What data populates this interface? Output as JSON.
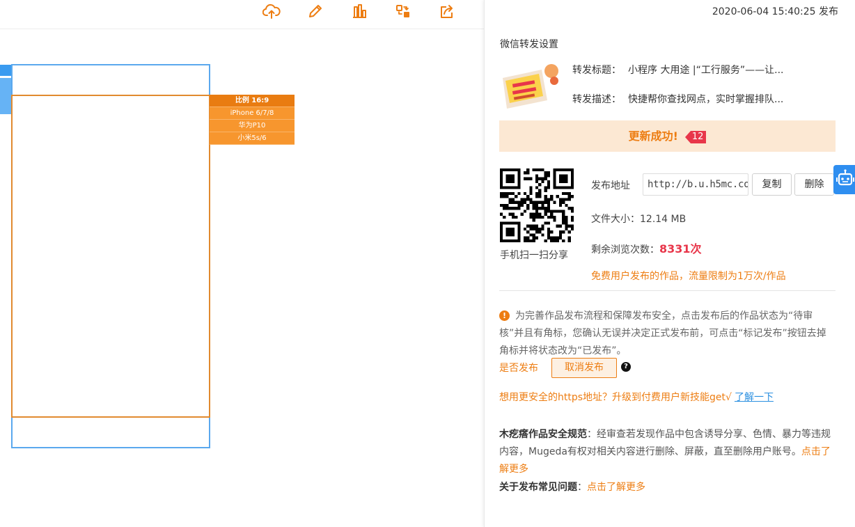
{
  "toolbar": {
    "icons": [
      "cloud-upload-icon",
      "pencil-icon",
      "bar-chart-icon",
      "share-transfer-icon",
      "export-icon"
    ]
  },
  "ratio_menu": {
    "items": [
      "比例 16:9",
      "iPhone 6/7/8",
      "华为P10",
      "小米5s/6"
    ],
    "active_index": 0
  },
  "panel": {
    "publish_time": "2020-06-04 15:40:25 发布",
    "wechat_title": "微信转发设置",
    "share_title_label": "转发标题：",
    "share_title_value": "小程序 大用途 |“工行服务”——让...",
    "share_desc_label": "转发描述：",
    "share_desc_value": "快捷帮你查找网点，实时掌握排队...",
    "success_text": "更新成功!",
    "success_count": "12",
    "qr_caption": "手机扫一扫分享",
    "address_label": "发布地址",
    "address_value": "http://b.u.h5mc.co",
    "copy_label": "复制",
    "delete_label": "删除",
    "file_size_label": "文件大小：",
    "file_size_value": "12.14 MB",
    "remaining_label": "剩余浏览次数：",
    "remaining_value": "8331次",
    "limit_note": "免费用户发布的作品，流量限制为1万次/作品",
    "notice_text": "为完善作品发布流程和保障发布安全，点击发布后的作品状态为“待审核”并且有角标，您确认无误并决定正式发布前，可点击“标记发布”按钮去掉角标并将状态改为“已发布”。",
    "publish_question": "是否发布",
    "cancel_publish": "取消发布",
    "https_text": "想用更安全的https地址？升级到付费用户新技能get√",
    "https_link": "了解一下",
    "rules_title": "木疙瘩作品安全规范",
    "rules_text": "：经审查若发现作品中包含诱导分享、色情、暴力等违规内容，Mugeda有权对相关内容进行删除、屏蔽，直至删除用户账号。",
    "rules_link": "点击了解更多",
    "faq_title": "关于发布常见问题",
    "faq_colon": "：",
    "faq_link": "点击了解更多"
  },
  "colors": {
    "accent_orange": "#ed7d12",
    "success_bg": "#fce8d3",
    "badge_red": "#e8364a",
    "frame_blue": "#5aa8ee",
    "frame_orange": "#e18a2f",
    "link_blue": "#2a8fe0"
  }
}
